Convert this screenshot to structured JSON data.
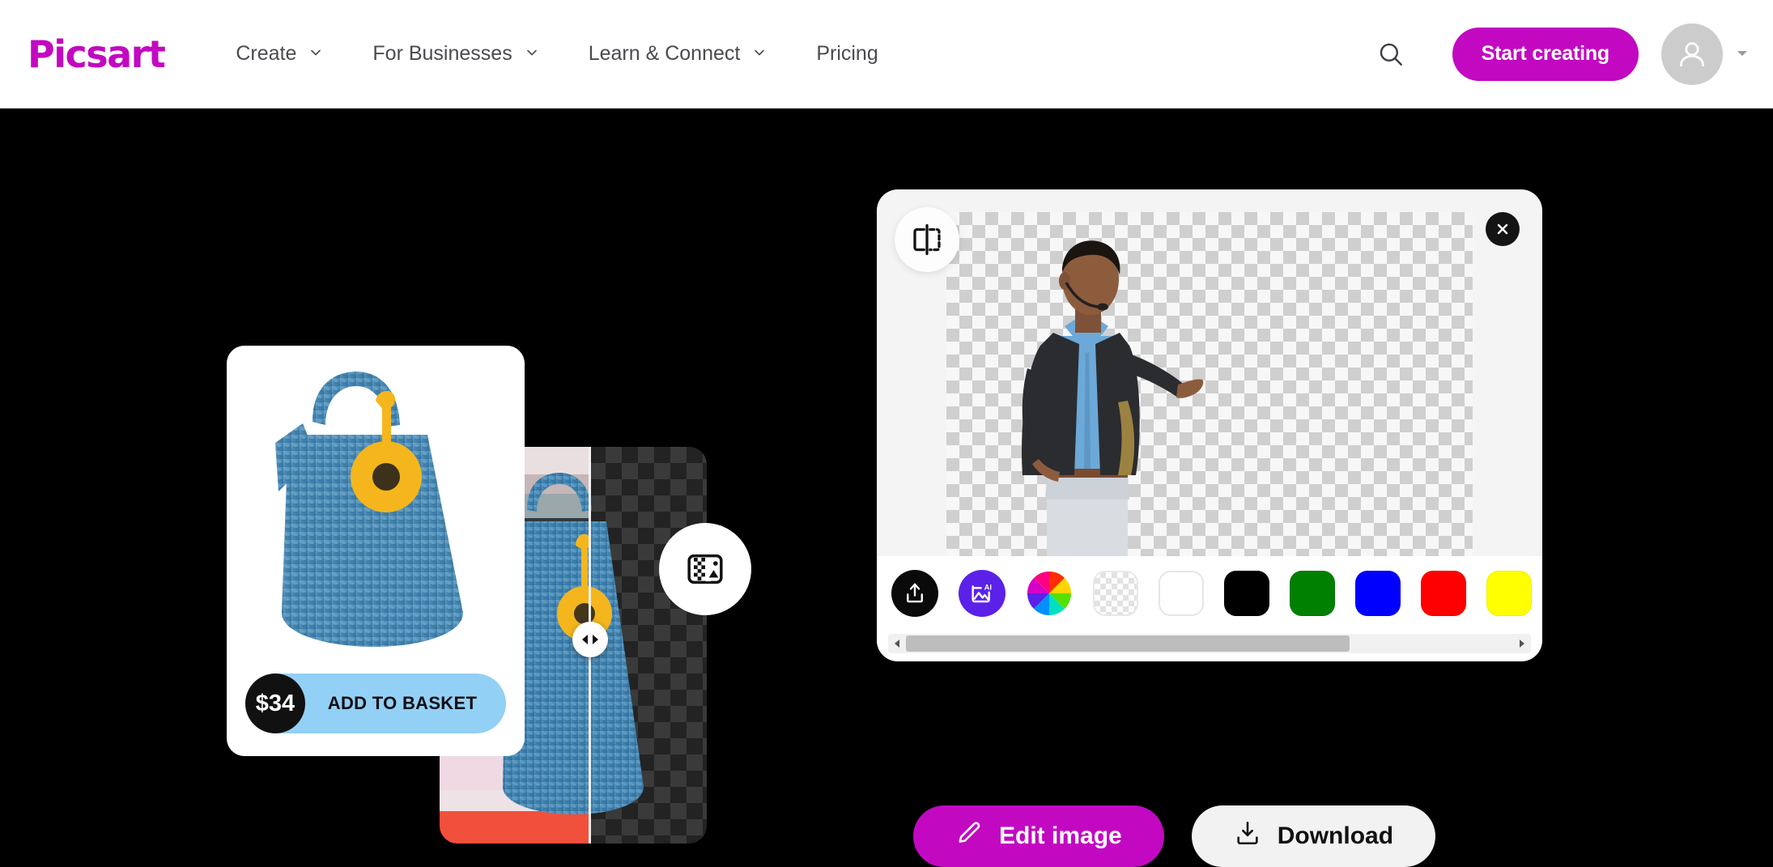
{
  "header": {
    "brand": "Picsart",
    "nav": [
      {
        "label": "Create",
        "icon": "chevron-down-icon",
        "has_chevron": true
      },
      {
        "label": "For Businesses",
        "icon": "chevron-down-icon",
        "has_chevron": true
      },
      {
        "label": "Learn & Connect",
        "icon": "chevron-down-icon",
        "has_chevron": true
      },
      {
        "label": "Pricing",
        "has_chevron": false
      }
    ],
    "search_icon": "search-icon",
    "cta_label": "Start creating",
    "avatar_icon": "user-avatar-icon",
    "avatar_caret_icon": "caret-down-icon",
    "brand_color": "#C209C1"
  },
  "left_composition": {
    "product_card": {
      "price": "$34",
      "basket_label": "ADD TO BASKET",
      "basket_color": "#93D0F5",
      "price_badge_color": "#111111",
      "product_name": "blue crochet tote bag"
    },
    "result_card": {
      "split_handle_icon": "horizontal-resize-handle-icon",
      "background_tool_icon": "replace-background-icon"
    }
  },
  "editor": {
    "flip_icon": "flip-horizontal-icon",
    "close_icon": "close-icon",
    "canvas_subject": "man speaking with headset microphone",
    "toolbar": {
      "tools": [
        {
          "name": "upload-background-button",
          "icon": "upload-icon",
          "color": "#0a0a0a"
        },
        {
          "name": "ai-background-button",
          "icon": "ai-image-icon",
          "color": "#5B21E8"
        },
        {
          "name": "color-picker-button",
          "icon": "color-wheel-icon",
          "color": "rainbow"
        }
      ],
      "swatches": [
        {
          "name": "transparent",
          "color": "transparent"
        },
        {
          "name": "white",
          "color": "#FFFFFF"
        },
        {
          "name": "black",
          "color": "#000000"
        },
        {
          "name": "green",
          "color": "#008000"
        },
        {
          "name": "blue",
          "color": "#0000FF"
        },
        {
          "name": "red",
          "color": "#FF0000"
        },
        {
          "name": "yellow",
          "color": "#FFFF00"
        }
      ],
      "scrollbar": {
        "left_arrow_icon": "arrow-left-icon",
        "right_arrow_icon": "arrow-right-icon",
        "thumb_percent": "73"
      }
    }
  },
  "actions": {
    "edit_label": "Edit image",
    "edit_icon": "pencil-icon",
    "download_label": "Download",
    "download_icon": "download-icon"
  }
}
